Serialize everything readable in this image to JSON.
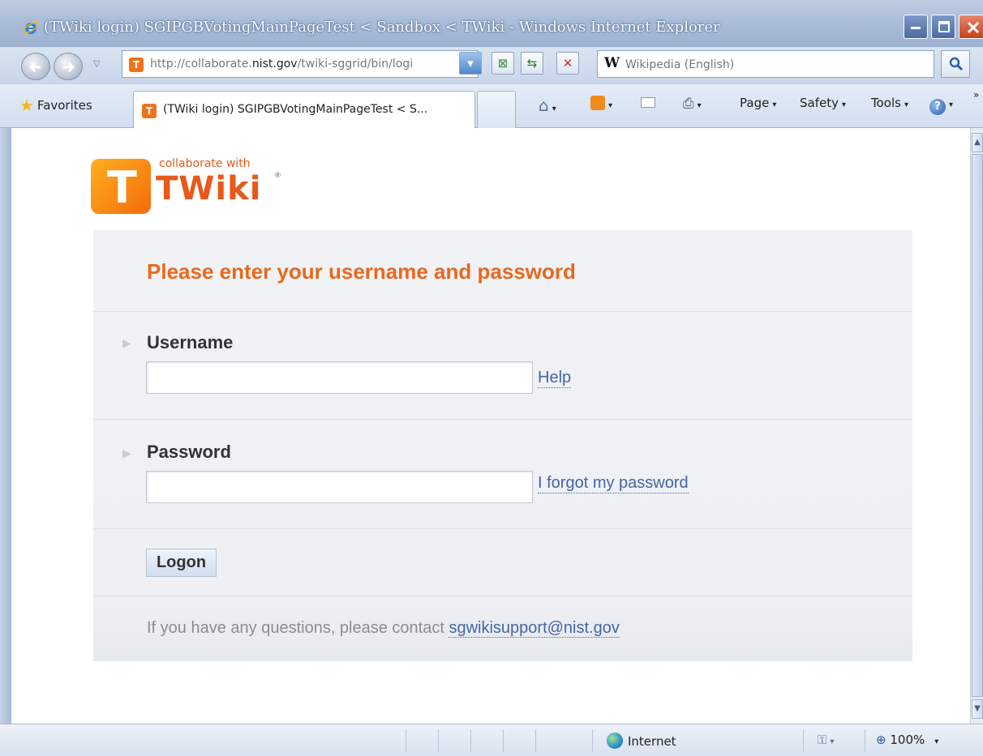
{
  "window": {
    "title": "(TWiki login) SGIPGBVotingMainPageTest < Sandbox < TWiki - Windows Internet Explorer"
  },
  "toolbar": {
    "url_prefix": "http://collaborate.",
    "url_domain": "nist.gov",
    "url_rest": "/twiki-sggrid/bin/logi",
    "search_provider_glyph": "W",
    "search_placeholder": "Wikipedia (English)"
  },
  "tabs": {
    "favorites_label": "Favorites",
    "active_tab_label": "(TWiki login) SGIPGBVotingMainPageTest < S...",
    "commands": {
      "page": "Page",
      "safety": "Safety",
      "tools": "Tools"
    }
  },
  "logo": {
    "tile_letter": "T",
    "tagline": "collaborate with",
    "wordmark": "TWiki",
    "registered": "®"
  },
  "login": {
    "heading": "Please enter your username and password",
    "username_label": "Username",
    "username_value": "",
    "help_link": "Help",
    "password_label": "Password",
    "password_value": "",
    "forgot_link": "I forgot my password",
    "logon_button": "Logon",
    "questions_text": "If you have any questions, please contact",
    "support_email": "sgwikisupport@nist.gov"
  },
  "statusbar": {
    "zone": "Internet",
    "zoom": "100%"
  },
  "colors": {
    "accent_orange": "#e8691c",
    "link_blue": "#4465a8",
    "panel_bg": "#f0f2f6"
  }
}
